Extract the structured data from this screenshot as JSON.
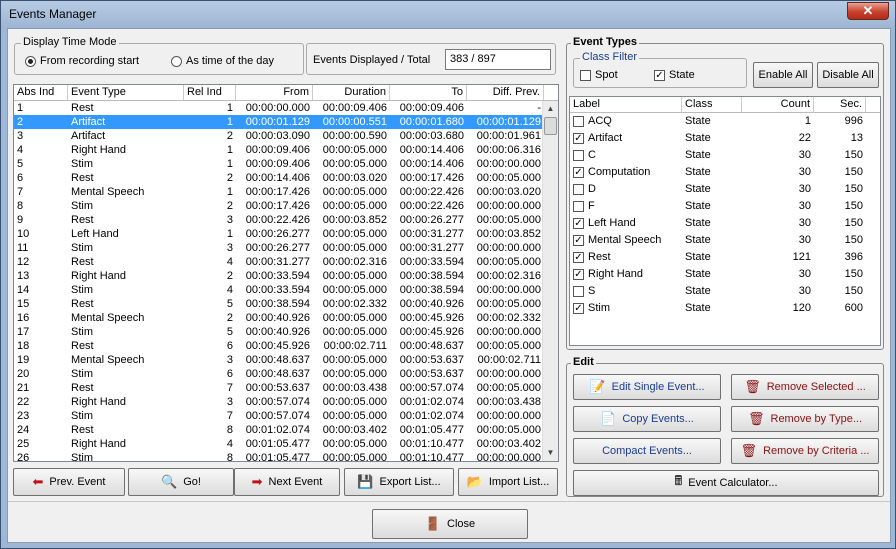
{
  "window": {
    "title": "Events Manager",
    "close_glyph": "✕"
  },
  "display_time_mode": {
    "label": "Display Time Mode",
    "options": [
      "From recording start",
      "As time of the day"
    ],
    "selected": 0
  },
  "events_displayed": {
    "label": "Events Displayed / Total",
    "value": "383 / 897"
  },
  "events_table": {
    "columns": [
      "Abs Ind",
      "Event Type",
      "Rel Ind",
      "From",
      "Duration",
      "To",
      "Diff. Prev."
    ],
    "selected_row": 1,
    "rows": [
      [
        "1",
        "Rest",
        "1",
        "00:00:00.000",
        "00:00:09.406",
        "00:00:09.406",
        "-"
      ],
      [
        "2",
        "Artifact",
        "1",
        "00:00:01.129",
        "00:00:00.551",
        "00:00:01.680",
        "00:00:01.129"
      ],
      [
        "3",
        "Artifact",
        "2",
        "00:00:03.090",
        "00:00:00.590",
        "00:00:03.680",
        "00:00:01.961"
      ],
      [
        "4",
        "Right Hand",
        "1",
        "00:00:09.406",
        "00:00:05.000",
        "00:00:14.406",
        "00:00:06.316"
      ],
      [
        "5",
        "Stim",
        "1",
        "00:00:09.406",
        "00:00:05.000",
        "00:00:14.406",
        "00:00:00.000"
      ],
      [
        "6",
        "Rest",
        "2",
        "00:00:14.406",
        "00:00:03.020",
        "00:00:17.426",
        "00:00:05.000"
      ],
      [
        "7",
        "Mental Speech",
        "1",
        "00:00:17.426",
        "00:00:05.000",
        "00:00:22.426",
        "00:00:03.020"
      ],
      [
        "8",
        "Stim",
        "2",
        "00:00:17.426",
        "00:00:05.000",
        "00:00:22.426",
        "00:00:00.000"
      ],
      [
        "9",
        "Rest",
        "3",
        "00:00:22.426",
        "00:00:03.852",
        "00:00:26.277",
        "00:00:05.000"
      ],
      [
        "10",
        "Left Hand",
        "1",
        "00:00:26.277",
        "00:00:05.000",
        "00:00:31.277",
        "00:00:03.852"
      ],
      [
        "11",
        "Stim",
        "3",
        "00:00:26.277",
        "00:00:05.000",
        "00:00:31.277",
        "00:00:00.000"
      ],
      [
        "12",
        "Rest",
        "4",
        "00:00:31.277",
        "00:00:02.316",
        "00:00:33.594",
        "00:00:05.000"
      ],
      [
        "13",
        "Right Hand",
        "2",
        "00:00:33.594",
        "00:00:05.000",
        "00:00:38.594",
        "00:00:02.316"
      ],
      [
        "14",
        "Stim",
        "4",
        "00:00:33.594",
        "00:00:05.000",
        "00:00:38.594",
        "00:00:00.000"
      ],
      [
        "15",
        "Rest",
        "5",
        "00:00:38.594",
        "00:00:02.332",
        "00:00:40.926",
        "00:00:05.000"
      ],
      [
        "16",
        "Mental Speech",
        "2",
        "00:00:40.926",
        "00:00:05.000",
        "00:00:45.926",
        "00:00:02.332"
      ],
      [
        "17",
        "Stim",
        "5",
        "00:00:40.926",
        "00:00:05.000",
        "00:00:45.926",
        "00:00:00.000"
      ],
      [
        "18",
        "Rest",
        "6",
        "00:00:45.926",
        "00:00:02.711",
        "00:00:48.637",
        "00:00:05.000"
      ],
      [
        "19",
        "Mental Speech",
        "3",
        "00:00:48.637",
        "00:00:05.000",
        "00:00:53.637",
        "00:00:02.711"
      ],
      [
        "20",
        "Stim",
        "6",
        "00:00:48.637",
        "00:00:05.000",
        "00:00:53.637",
        "00:00:00.000"
      ],
      [
        "21",
        "Rest",
        "7",
        "00:00:53.637",
        "00:00:03.438",
        "00:00:57.074",
        "00:00:05.000"
      ],
      [
        "22",
        "Right Hand",
        "3",
        "00:00:57.074",
        "00:00:05.000",
        "00:01:02.074",
        "00:00:03.438"
      ],
      [
        "23",
        "Stim",
        "7",
        "00:00:57.074",
        "00:00:05.000",
        "00:01:02.074",
        "00:00:00.000"
      ],
      [
        "24",
        "Rest",
        "8",
        "00:01:02.074",
        "00:00:03.402",
        "00:01:05.477",
        "00:00:05.000"
      ],
      [
        "25",
        "Right Hand",
        "4",
        "00:01:05.477",
        "00:00:05.000",
        "00:01:10.477",
        "00:00:03.402"
      ],
      [
        "26",
        "Stim",
        "8",
        "00:01:05.477",
        "00:00:05.000",
        "00:01:10.477",
        "00:00:00.000"
      ]
    ]
  },
  "nav_buttons": [
    {
      "label": "Prev. Event",
      "icon": "left-arrow-icon",
      "glyph": "⬅"
    },
    {
      "label": "Go!",
      "icon": "magnifier-icon",
      "glyph": "🔍"
    },
    {
      "label": "Next Event",
      "icon": "right-arrow-icon",
      "glyph": "➡"
    },
    {
      "label": "Export List...",
      "icon": "floppy-icon",
      "glyph": "💾"
    },
    {
      "label": "Import List...",
      "icon": "folder-icon",
      "glyph": "📂"
    }
  ],
  "event_types": {
    "label": "Event Types",
    "class_filter": {
      "label": "Class Filter",
      "options": [
        {
          "label": "Spot",
          "checked": false
        },
        {
          "label": "State",
          "checked": true
        }
      ]
    },
    "enable_all": "Enable All",
    "disable_all": "Disable All",
    "columns": [
      "Label",
      "Class",
      "Count",
      "Sec."
    ],
    "rows": [
      {
        "checked": false,
        "label": "ACQ",
        "class": "State",
        "count": "1",
        "sec": "996"
      },
      {
        "checked": true,
        "label": "Artifact",
        "class": "State",
        "count": "22",
        "sec": "13"
      },
      {
        "checked": false,
        "label": "C",
        "class": "State",
        "count": "30",
        "sec": "150"
      },
      {
        "checked": true,
        "label": "Computation",
        "class": "State",
        "count": "30",
        "sec": "150"
      },
      {
        "checked": false,
        "label": "D",
        "class": "State",
        "count": "30",
        "sec": "150"
      },
      {
        "checked": false,
        "label": "F",
        "class": "State",
        "count": "30",
        "sec": "150"
      },
      {
        "checked": true,
        "label": "Left Hand",
        "class": "State",
        "count": "30",
        "sec": "150"
      },
      {
        "checked": true,
        "label": "Mental Speech",
        "class": "State",
        "count": "30",
        "sec": "150"
      },
      {
        "checked": true,
        "label": "Rest",
        "class": "State",
        "count": "121",
        "sec": "396"
      },
      {
        "checked": true,
        "label": "Right Hand",
        "class": "State",
        "count": "30",
        "sec": "150"
      },
      {
        "checked": false,
        "label": "S",
        "class": "State",
        "count": "30",
        "sec": "150"
      },
      {
        "checked": true,
        "label": "Stim",
        "class": "State",
        "count": "120",
        "sec": "600"
      }
    ]
  },
  "edit": {
    "label": "Edit",
    "edit_single": "Edit Single Event...",
    "remove_selected": "Remove Selected ...",
    "copy_events": "Copy Events...",
    "remove_by_type": "Remove by Type...",
    "compact_events": "Compact Events...",
    "remove_by_criteria": "Remove by Criteria ...",
    "event_calculator": "Event Calculator..."
  },
  "close_button": "Close",
  "colors": {
    "selection": "#3399ff",
    "remove_text": "#8b1010",
    "link_text": "#1a3d8f"
  }
}
